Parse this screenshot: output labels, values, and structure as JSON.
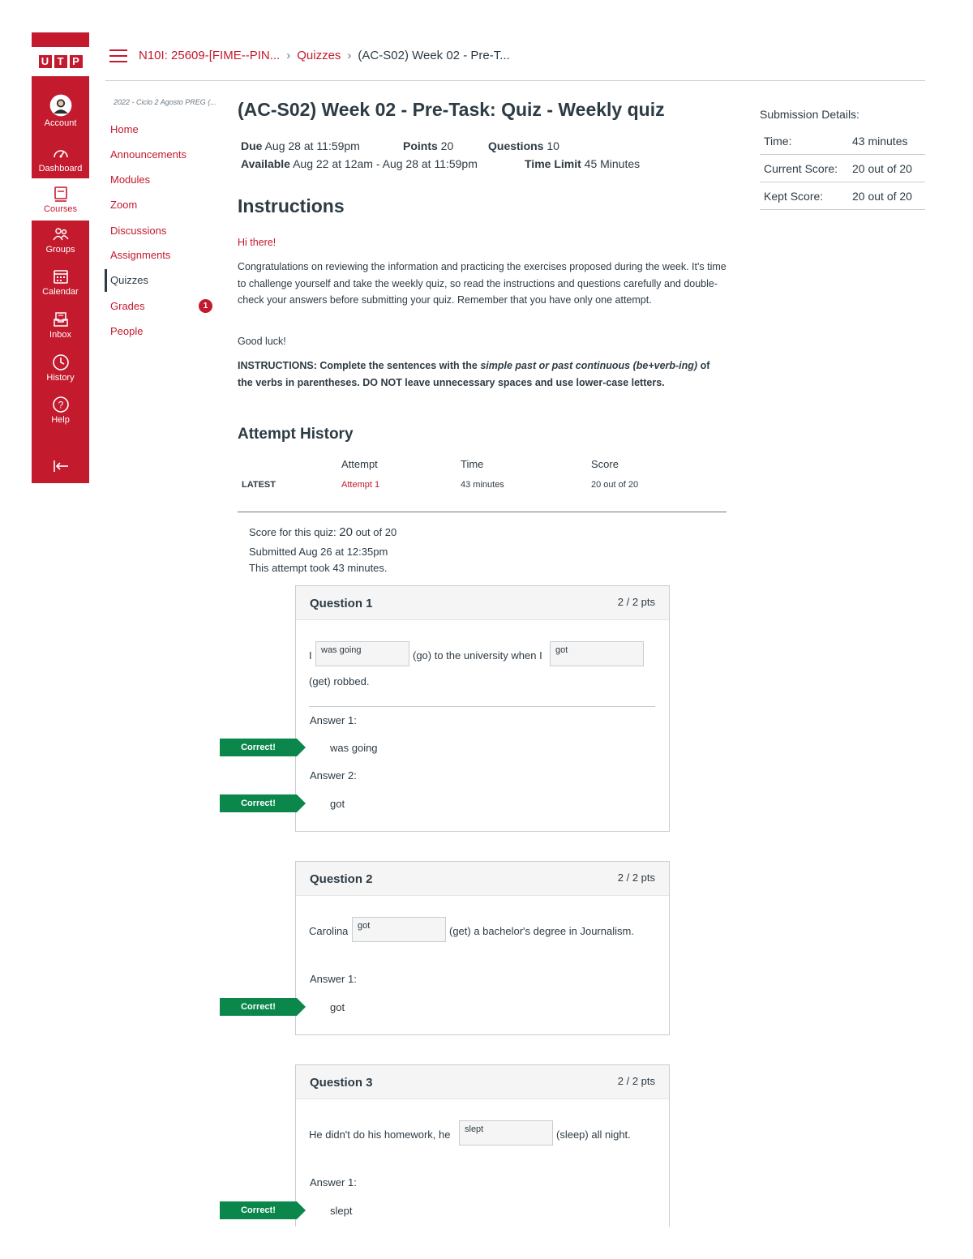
{
  "brand": {
    "logo_letters": [
      "U",
      "T",
      "P"
    ],
    "accent": "#c31a2e",
    "correct_color": "#0b874b"
  },
  "global_nav": [
    {
      "label": "Account",
      "icon": "avatar-icon"
    },
    {
      "label": "Dashboard",
      "icon": "dashboard-icon"
    },
    {
      "label": "Courses",
      "icon": "courses-icon"
    },
    {
      "label": "Groups",
      "icon": "groups-icon"
    },
    {
      "label": "Calendar",
      "icon": "calendar-icon"
    },
    {
      "label": "Inbox",
      "icon": "inbox-icon"
    },
    {
      "label": "History",
      "icon": "history-icon"
    },
    {
      "label": "Help",
      "icon": "help-icon"
    },
    {
      "label": "",
      "icon": "collapse-icon"
    }
  ],
  "breadcrumb": {
    "course": "N10I: 25609-[FIME--PIN...",
    "section": "Quizzes",
    "current": "(AC-S02) Week 02 - Pre-T..."
  },
  "course_nav": {
    "term": "2022 - Ciclo 2 Agosto PREG (...",
    "items": [
      "Home",
      "Announcements",
      "Modules",
      "Zoom",
      "Discussions",
      "Assignments",
      "Quizzes",
      "Grades",
      "People"
    ],
    "active": "Quizzes",
    "grades_badge": "1"
  },
  "quiz": {
    "title": "(AC-S02) Week 02 - Pre-Task: Quiz - Weekly quiz",
    "due_label": "Due",
    "due": "Aug 28 at 11:59pm",
    "points_label": "Points",
    "points": "20",
    "questions_label": "Questions",
    "questions": "10",
    "available_label": "Available",
    "available": "Aug 22 at 12am - Aug 28 at 11:59pm",
    "time_limit_label": "Time Limit",
    "time_limit": "45 Minutes"
  },
  "instructions": {
    "heading": "Instructions",
    "greeting": "Hi there!",
    "body": "Congratulations on reviewing the information and practicing the exercises proposed during the week. It's time to challenge yourself and take the weekly quiz, so read the instructions and questions carefully and double-check your answers before submitting your quiz. Remember that you have only one attempt.",
    "good_luck": "Good luck!",
    "rule_prefix": "INSTRUCTIONS: Complete the sentences with the ",
    "rule_emph": "simple past or past continuous (be+verb-ing)",
    "rule_suffix": " of the verbs in parentheses. DO NOT leave unnecessary spaces and use lower-case letters."
  },
  "attempt_history": {
    "title": "Attempt History",
    "headers": [
      "Attempt",
      "Time",
      "Score"
    ],
    "row": {
      "tag": "LATEST",
      "attempt": "Attempt 1",
      "time": "43 minutes",
      "score": "20 out of 20"
    }
  },
  "summary": {
    "score_prefix": "Score for this quiz: ",
    "score": "20",
    "score_suffix": " out of 20",
    "submitted": "Submitted Aug 26 at 12:35pm",
    "took": "This attempt took 43 minutes."
  },
  "submission_details": {
    "title": "Submission Details:",
    "rows": [
      {
        "key": "Time:",
        "value": "43 minutes"
      },
      {
        "key": "Current Score:",
        "value": "20 out of 20"
      },
      {
        "key": "Kept Score:",
        "value": "20 out of 20"
      }
    ]
  },
  "questions": [
    {
      "title": "Question 1",
      "pts": "2 / 2 pts",
      "text_a": "I",
      "input_1": "was going",
      "text_b": "(go) to the university when I",
      "input_2": "got",
      "text_c": "(get) robbed.",
      "answers": [
        {
          "label": "Answer 1:",
          "value": "was going",
          "badge": "Correct!"
        },
        {
          "label": "Answer 2:",
          "value": "got",
          "badge": "Correct!"
        }
      ]
    },
    {
      "title": "Question 2",
      "pts": "2 / 2 pts",
      "text_a": "Carolina",
      "input_1": "got",
      "text_b": "(get) a bachelor's degree in Journalism.",
      "answers": [
        {
          "label": "Answer 1:",
          "value": "got",
          "badge": "Correct!"
        }
      ]
    },
    {
      "title": "Question 3",
      "pts": "2 / 2 pts",
      "text_a": "He didn't do his homework, he",
      "input_1": "slept",
      "text_b": "(sleep) all night.",
      "answers": [
        {
          "label": "Answer 1:",
          "value": "slept",
          "badge": "Correct!"
        }
      ]
    }
  ]
}
